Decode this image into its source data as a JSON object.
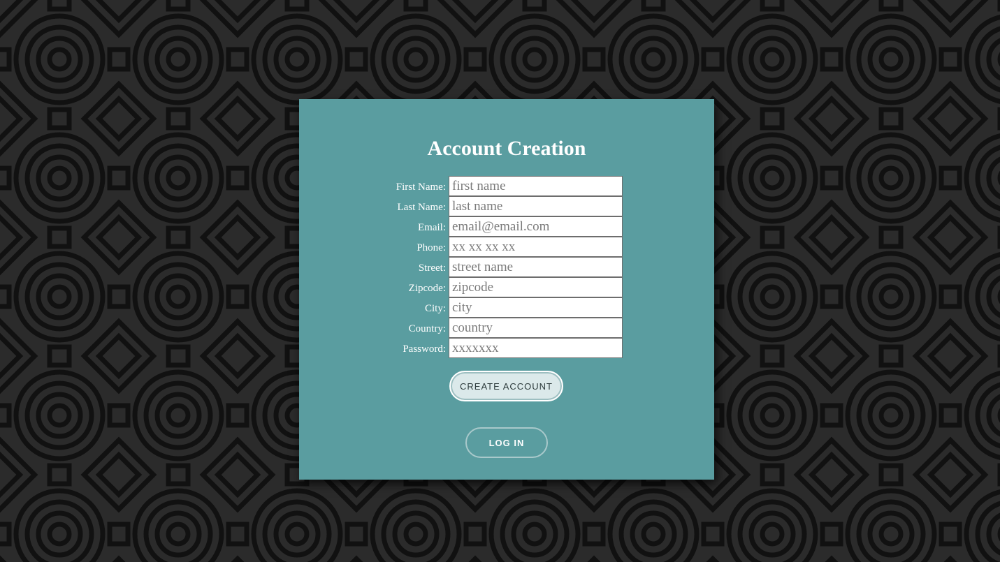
{
  "colors": {
    "background": "#2b2b2b",
    "pattern_stroke": "#111111",
    "card_background": "#5a9da0",
    "button_create_bg": "#dbe9ea"
  },
  "page": {
    "title": "Account Creation"
  },
  "form": {
    "fields": [
      {
        "label": "First Name:",
        "placeholder": "first name",
        "value": ""
      },
      {
        "label": "Last Name:",
        "placeholder": "last name",
        "value": ""
      },
      {
        "label": "Email:",
        "placeholder": "email@email.com",
        "value": ""
      },
      {
        "label": "Phone:",
        "placeholder": "xx xx xx xx",
        "value": ""
      },
      {
        "label": "Street:",
        "placeholder": "street name",
        "value": ""
      },
      {
        "label": "Zipcode:",
        "placeholder": "zipcode",
        "value": ""
      },
      {
        "label": "City:",
        "placeholder": "city",
        "value": ""
      },
      {
        "label": "Country:",
        "placeholder": "country",
        "value": ""
      },
      {
        "label": "Password:",
        "placeholder": "xxxxxxx",
        "value": ""
      }
    ]
  },
  "buttons": {
    "create_account": "CREATE ACCOUNT",
    "log_in": "LOG IN"
  }
}
